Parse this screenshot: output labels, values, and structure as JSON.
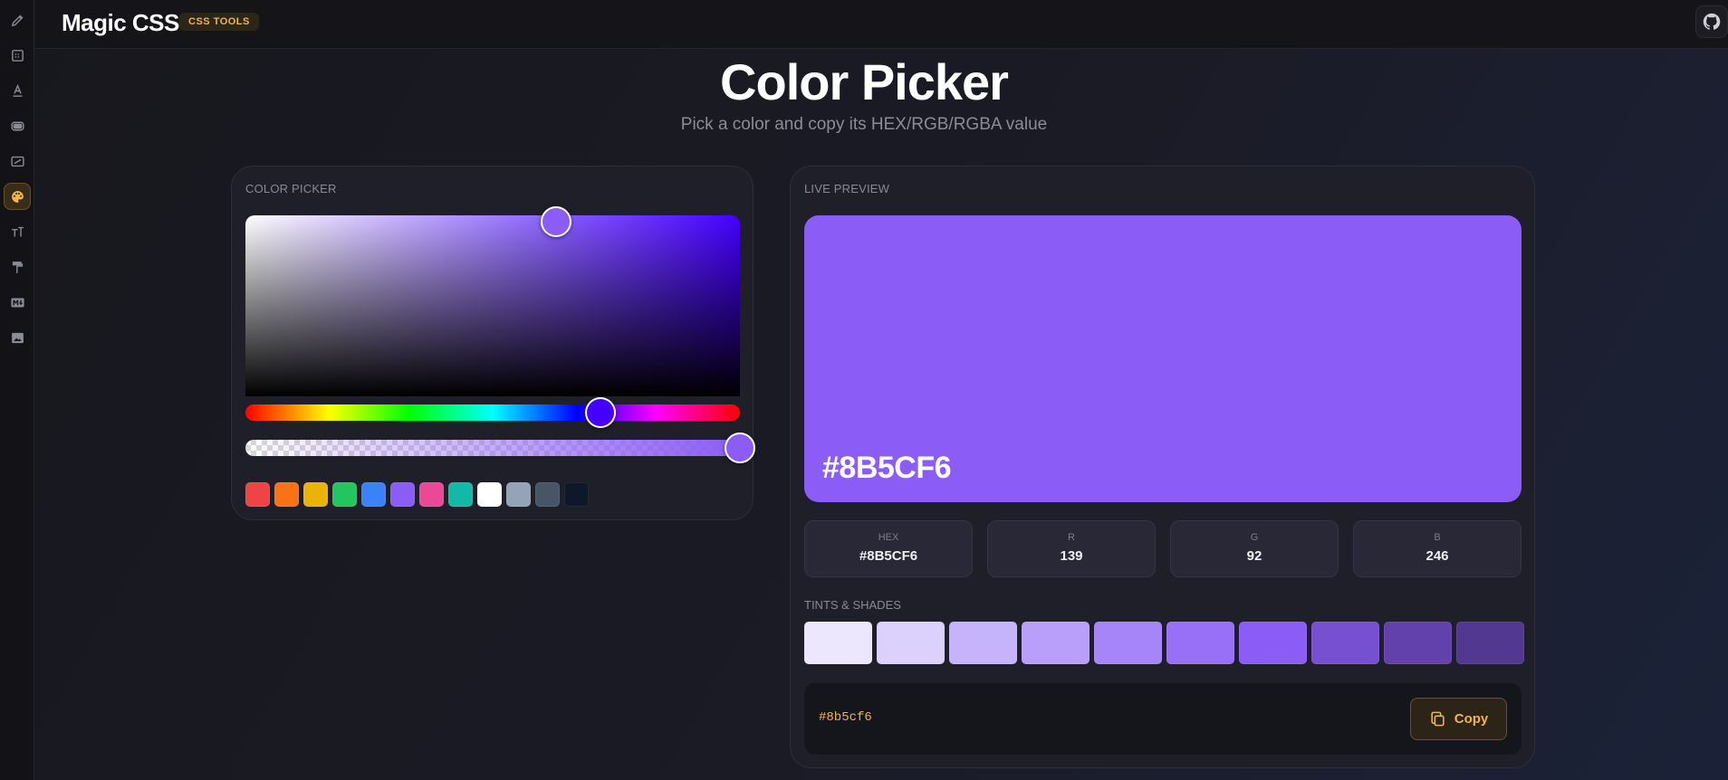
{
  "app": {
    "title": "Magic CSS",
    "badge": "CSS TOOLS"
  },
  "sidebar": {
    "items": [
      {
        "icon": "pen-icon",
        "active": false
      },
      {
        "icon": "grid-icon",
        "active": false
      },
      {
        "icon": "text-underline-icon",
        "active": false
      },
      {
        "icon": "border-radius-icon",
        "active": false
      },
      {
        "icon": "aspect-ratio-icon",
        "active": false
      },
      {
        "icon": "palette-icon",
        "active": true
      },
      {
        "icon": "font-size-icon",
        "active": false
      },
      {
        "icon": "paint-roller-icon",
        "active": false
      },
      {
        "icon": "markdown-icon",
        "active": false
      },
      {
        "icon": "image-icon",
        "active": false
      }
    ]
  },
  "header": {
    "title": "Color Picker",
    "subtitle": "Pick a color and copy its HEX/RGB/RGBA value"
  },
  "picker": {
    "label": "COLOR PICKER",
    "current_color": "#8B5CF6",
    "hue_color": "#4400FF",
    "alpha": 1,
    "swatches": [
      "#ef4444",
      "#f97316",
      "#eab308",
      "#22c55e",
      "#3b82f6",
      "#8b5cf6",
      "#ec4899",
      "#14b8a6",
      "#ffffff",
      "#94a3b8",
      "#475569",
      "#0f172a"
    ]
  },
  "preview": {
    "label": "LIVE PREVIEW",
    "hex_display": "#8B5CF6",
    "color": "#8B5CF6",
    "values": [
      {
        "label": "HEX",
        "value": "#8B5CF6"
      },
      {
        "label": "R",
        "value": "139"
      },
      {
        "label": "G",
        "value": "92"
      },
      {
        "label": "B",
        "value": "246"
      }
    ],
    "tints_label": "TINTS & SHADES",
    "tints": [
      "#ede7fe",
      "#dcd0fc",
      "#c5b3fb",
      "#b99ffa",
      "#a685f8",
      "#9870f7",
      "#8b5cf6",
      "#7650d0",
      "#6341ac",
      "#523890"
    ],
    "copy_value": "#8b5cf6",
    "copy_label": "Copy"
  }
}
